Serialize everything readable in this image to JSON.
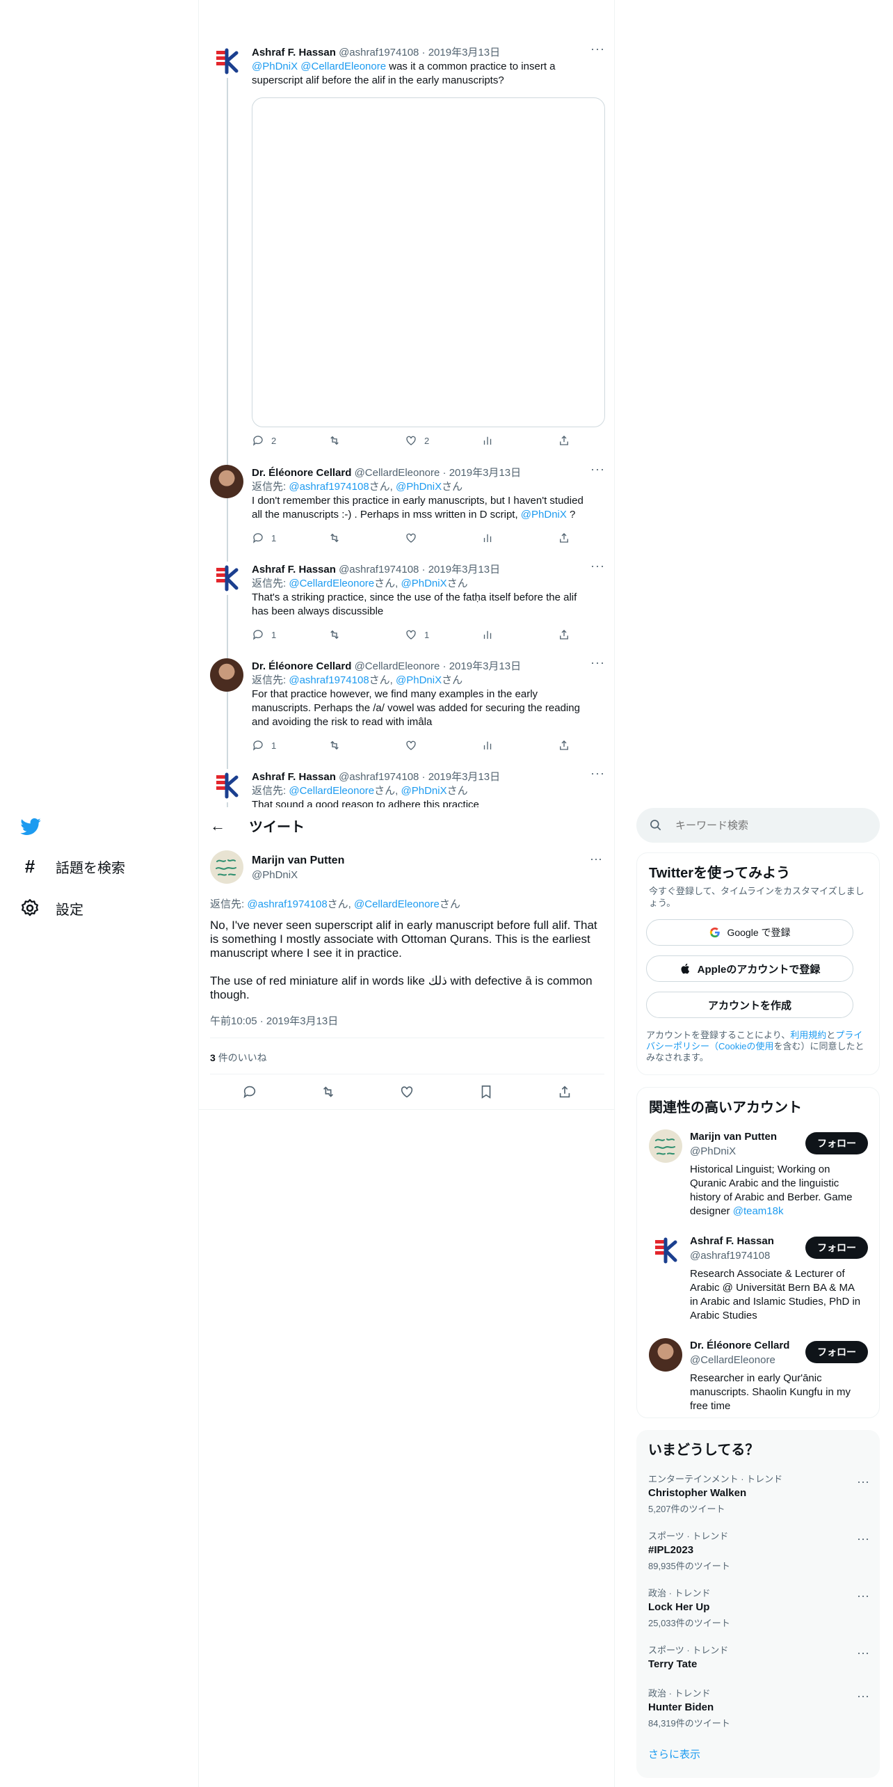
{
  "nav": {
    "explore_label": "話題を検索",
    "settings_label": "設定"
  },
  "thread": [
    {
      "name": "Ashraf F. Hassan",
      "handle": "@ashraf1974108",
      "date": "2019年3月13日",
      "reply_prefix": "",
      "reply_to": [],
      "mentions": [
        "@PhDniX",
        "@CellardEleonore"
      ],
      "text": "was it a common practice to insert a superscript alif before the alif in the early manuscripts?",
      "replies": "2",
      "retweets": "",
      "likes": "2"
    },
    {
      "name": "Dr. Éléonore Cellard",
      "handle": "@CellardEleonore",
      "date": "2019年3月13日",
      "reply_prefix": "返信先: ",
      "reply_to": [
        "@ashraf1974108",
        "@PhDniX"
      ],
      "text": "I don't remember this practice in early manuscripts, but I haven't studied all the manuscripts :-) . Perhaps in mss written in D script,",
      "text_mention": "@PhDniX",
      "text_tail": " ?",
      "replies": "1",
      "retweets": "",
      "likes": ""
    },
    {
      "name": "Ashraf F. Hassan",
      "handle": "@ashraf1974108",
      "date": "2019年3月13日",
      "reply_prefix": "返信先: ",
      "reply_to": [
        "@CellardEleonore",
        "@PhDniX"
      ],
      "text": "That's a striking practice, since the use of the fatḥa itself before the alif has been always discussible",
      "replies": "1",
      "retweets": "",
      "likes": "1"
    },
    {
      "name": "Dr. Éléonore Cellard",
      "handle": "@CellardEleonore",
      "date": "2019年3月13日",
      "reply_prefix": "返信先: ",
      "reply_to": [
        "@ashraf1974108",
        "@PhDniX"
      ],
      "text": "For that practice however, we find many examples in the early manuscripts. Perhaps the /a/ vowel was added for securing the reading and avoiding the risk to read with imâla",
      "replies": "1",
      "retweets": "",
      "likes": ""
    },
    {
      "name": "Ashraf F. Hassan",
      "handle": "@ashraf1974108",
      "date": "2019年3月13日",
      "reply_prefix": "返信先: ",
      "reply_to": [
        "@CellardEleonore",
        "@PhDniX"
      ],
      "text": "That sound a good reason to adhere this practice"
    }
  ],
  "san": "さん",
  "comma": ", ",
  "header": {
    "title": "ツイート"
  },
  "main_tweet": {
    "name": "Marijn van Putten",
    "handle": "@PhDniX",
    "reply_prefix": "返信先: ",
    "reply_to": [
      "@ashraf1974108",
      "@CellardEleonore"
    ],
    "paragraph1": "No, I've never seen superscript alif in early manuscript before full alif. That is something I mostly associate with Ottoman Qurans. This is the earliest manuscript where I see it in practice.",
    "paragraph2": "The use of red miniature alif in words like ذلك with defective ā is common though.",
    "timestamp": "午前10:05 · 2019年3月13日",
    "likes_count": "3",
    "likes_label": "件のいいね"
  },
  "search": {
    "placeholder": "キーワード検索"
  },
  "signup": {
    "title": "Twitterを使ってみよう",
    "subtitle": "今すぐ登録して、タイムラインをカスタマイズしましょう。",
    "google": "Google で登録",
    "apple": "Appleのアカウントで登録",
    "create": "アカウントを作成",
    "legal_1": "アカウントを登録することにより、",
    "legal_terms": "利用規約",
    "legal_and": "と",
    "legal_privacy": "プライバシーポリシー",
    "legal_paren_open": "（",
    "legal_cookie": "Cookieの使用",
    "legal_rest": "を含む）に同意したとみなされます。"
  },
  "relevant": {
    "title": "関連性の高いアカウント",
    "follow": "フォロー",
    "accounts": [
      {
        "name": "Marijn van Putten",
        "handle": "@PhDniX",
        "bio": "Historical Linguist; Working on Quranic Arabic and the linguistic history of Arabic and Berber. Game designer",
        "bio_link": "@team18k"
      },
      {
        "name": "Ashraf F. Hassan",
        "handle": "@ashraf1974108",
        "bio": "Research Associate & Lecturer of Arabic @ Universität Bern BA & MA in Arabic and Islamic Studies, PhD in Arabic Studies",
        "bio_link": ""
      },
      {
        "name": "Dr. Éléonore Cellard",
        "handle": "@CellardEleonore",
        "bio": "Researcher in early Qur'ānic manuscripts. Shaolin Kungfu in my free time",
        "bio_link": ""
      }
    ]
  },
  "trends": {
    "title": "いまどうしてる？",
    "show_more": "さらに表示",
    "items": [
      {
        "category": "エンターテインメント · トレンド",
        "name": "Christopher Walken",
        "count": "5,207件のツイート"
      },
      {
        "category": "スポーツ · トレンド",
        "name": "#IPL2023",
        "count": "89,935件のツイート"
      },
      {
        "category": "政治 · トレンド",
        "name": "Lock Her Up",
        "count": "25,033件のツイート"
      },
      {
        "category": "スポーツ · トレンド",
        "name": "Terry Tate",
        "count": ""
      },
      {
        "category": "政治 · トレンド",
        "name": "Hunter Biden",
        "count": "84,319件のツイート"
      }
    ]
  },
  "colors": {
    "accent": "#1d9bf0",
    "text": "#0f1419",
    "muted": "#536471",
    "red_logo": "#e3262c",
    "blue_logo": "#1b3f8f"
  }
}
